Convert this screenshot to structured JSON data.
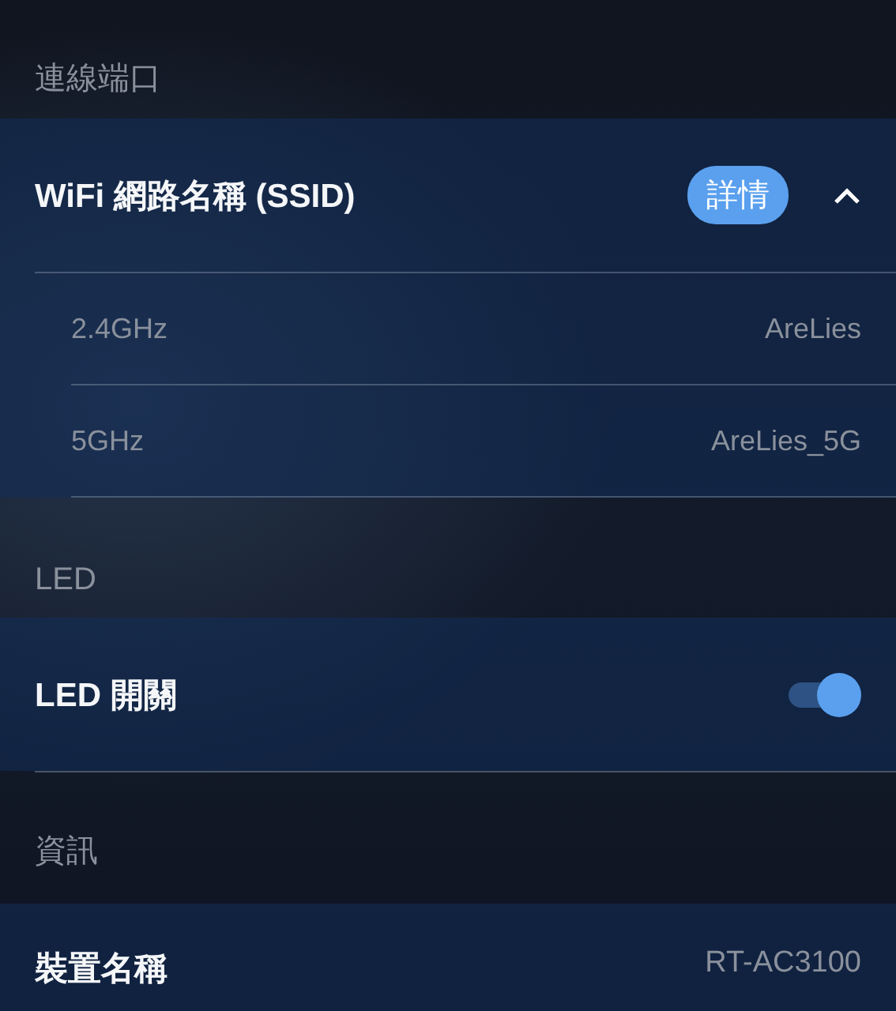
{
  "sections": [
    {
      "header": "連線端口",
      "items": [
        {
          "kind": "expandable",
          "label": "WiFi 網路名稱 (SSID)",
          "button": "詳情",
          "expanded": true,
          "children": [
            {
              "label": "2.4GHz",
              "value": "AreLies"
            },
            {
              "label": "5GHz",
              "value": "AreLies_5G"
            }
          ]
        }
      ]
    },
    {
      "header": "LED",
      "items": [
        {
          "kind": "toggle",
          "label": "LED 開關",
          "on": true
        }
      ]
    },
    {
      "header": "資訊",
      "items": [
        {
          "kind": "value",
          "label": "裝置名稱",
          "value": "RT-AC3100"
        }
      ]
    }
  ]
}
